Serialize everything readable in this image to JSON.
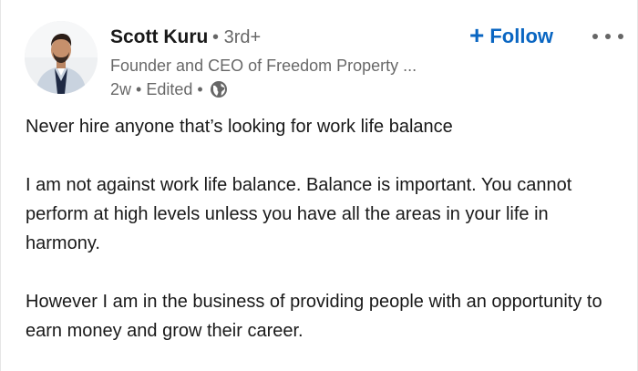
{
  "actor": {
    "name": "Scott Kuru",
    "separator": "•",
    "degree": "3rd+",
    "headline": "Founder and CEO of Freedom Property ...",
    "time": "2w",
    "edited": "Edited",
    "visibility_icon": "globe-icon",
    "avatar_icon": "profile-photo"
  },
  "actions": {
    "follow_icon": "plus-icon",
    "follow_label": "Follow",
    "more_icon": "ellipsis-icon"
  },
  "post": {
    "paragraphs": [
      "Never hire anyone that’s looking for work life balance",
      "I am not against work life balance. Balance is important. You cannot perform at high levels unless you have all the areas in your life in harmony.",
      "However I am in the business of providing people with an opportunity to earn money and grow their career."
    ]
  },
  "colors": {
    "brand_blue": "#0a66c2",
    "text_primary": "rgba(0,0,0,0.9)",
    "text_secondary": "rgba(0,0,0,0.6)"
  }
}
